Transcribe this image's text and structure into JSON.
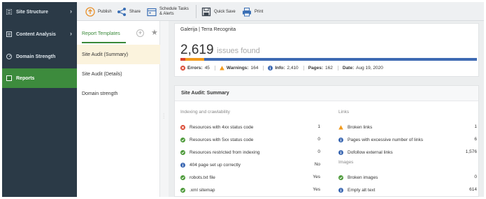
{
  "sidebar": {
    "items": [
      {
        "label": "Site Structure",
        "icon": "list-icon"
      },
      {
        "label": "Content Analysis",
        "icon": "document-icon"
      },
      {
        "label": "Domain Strength",
        "icon": "gauge-icon"
      },
      {
        "label": "Reports",
        "icon": "reports-icon"
      }
    ],
    "active": "Reports"
  },
  "toolbar": {
    "publish": "Publish",
    "share": "Share",
    "schedule_line1": "Schedule Tasks",
    "schedule_line2": "& Alerts",
    "quick_save": "Quick Save",
    "print": "Print"
  },
  "templates": {
    "tab_label": "Report Templates",
    "items": [
      "Site Audit (Summary)",
      "Site Audit (Details)",
      "Domain strength"
    ]
  },
  "summary": {
    "site": "Galerija | Terra Recognita",
    "issues_count": "2,619",
    "issues_label": "issues found",
    "errors_label": "Errors:",
    "errors": "45",
    "warnings_label": "Warnings:",
    "warnings": "164",
    "info_label": "Info:",
    "info": "2,410",
    "pages_label": "Pages:",
    "pages": "162",
    "date_label": "Date:",
    "date": "Aug 19, 2020",
    "colors": {
      "error": "#d9442e",
      "warning": "#f29b1d",
      "info": "#3e6ab3"
    },
    "bar_fractions": {
      "error": 0.017,
      "warning": 0.063,
      "info": 0.92
    }
  },
  "audit": {
    "title": "Site Audit: Summary",
    "left_section": "Indexing and crawlability",
    "left_rows": [
      {
        "label": "Resources with 4xx status code",
        "value": "1",
        "status": "error"
      },
      {
        "label": "Resources with 5xx status code",
        "value": "0",
        "status": "ok"
      },
      {
        "label": "Resources restricted from indexing",
        "value": "0",
        "status": "ok"
      },
      {
        "label": "404 page set up correctly",
        "value": "No",
        "status": "info"
      },
      {
        "label": "robots.txt file",
        "value": "Yes",
        "status": "ok"
      },
      {
        "label": ".xml sitemap",
        "value": "Yes",
        "status": "ok"
      }
    ],
    "right_section1": "Links",
    "right_rows1": [
      {
        "label": "Broken links",
        "value": "1",
        "status": "warning"
      },
      {
        "label": "Pages with excessive number of links",
        "value": "6",
        "status": "info"
      },
      {
        "label": "Dofollow external links",
        "value": "1,576",
        "status": "info"
      }
    ],
    "right_section2": "Images",
    "right_rows2": [
      {
        "label": "Broken images",
        "value": "0",
        "status": "ok"
      },
      {
        "label": "Empty alt text",
        "value": "614",
        "status": "info"
      }
    ]
  }
}
